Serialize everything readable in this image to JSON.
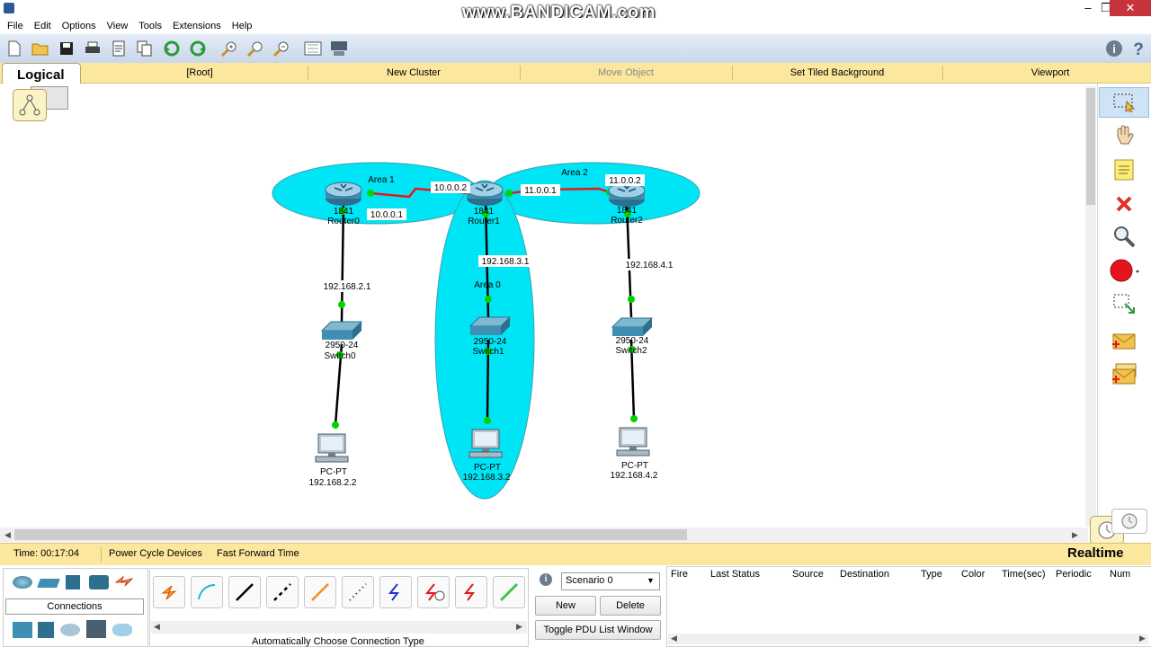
{
  "watermark": "www.BANDICAM.com",
  "menu": [
    "File",
    "Edit",
    "Options",
    "View",
    "Tools",
    "Extensions",
    "Help"
  ],
  "workspace_bar": {
    "tab": "Logical",
    "items": [
      "[Root]",
      "New Cluster",
      "Move Object",
      "Set Tiled Background",
      "Viewport"
    ]
  },
  "topology": {
    "areas": [
      "Area 1",
      "Area 2",
      "Area 0"
    ],
    "routers": [
      {
        "model": "1841",
        "name": "Router0"
      },
      {
        "model": "1841",
        "name": "Router1"
      },
      {
        "model": "1841",
        "name": "Router2"
      }
    ],
    "switches": [
      {
        "model": "2950-24",
        "name": "Switch0"
      },
      {
        "model": "2950-24",
        "name": "Switch1"
      },
      {
        "model": "2950-24",
        "name": "Switch2"
      }
    ],
    "pcs": [
      {
        "model": "PC-PT",
        "ip": "192.168.2.2"
      },
      {
        "model": "PC-PT",
        "ip": "192.168.3.2"
      },
      {
        "model": "PC-PT",
        "ip": "192.168.4.2"
      }
    ],
    "link_labels": [
      "10.0.0.2",
      "10.0.0.1",
      "11.0.0.1",
      "11.0.0.2",
      "192.168.2.1",
      "192.168.3.1",
      "192.168.4.1"
    ]
  },
  "status": {
    "time": "Time: 00:17:04",
    "power_cycle": "Power Cycle Devices",
    "fast_forward": "Fast Forward Time",
    "mode": "Realtime"
  },
  "bottom": {
    "category_label": "Connections",
    "connection_type": "Automatically Choose Connection Type",
    "scenario": "Scenario 0",
    "new": "New",
    "delete": "Delete",
    "toggle": "Toggle PDU List Window",
    "pdu_columns": [
      "Fire",
      "Last Status",
      "Source",
      "Destination",
      "Type",
      "Color",
      "Time(sec)",
      "Periodic",
      "Num"
    ]
  },
  "colors": {
    "area": "#00e5f5",
    "serial": "#e8161b",
    "ethernet": "#000000",
    "link_up": "#00d400",
    "ws_bar": "#fbe79d"
  }
}
